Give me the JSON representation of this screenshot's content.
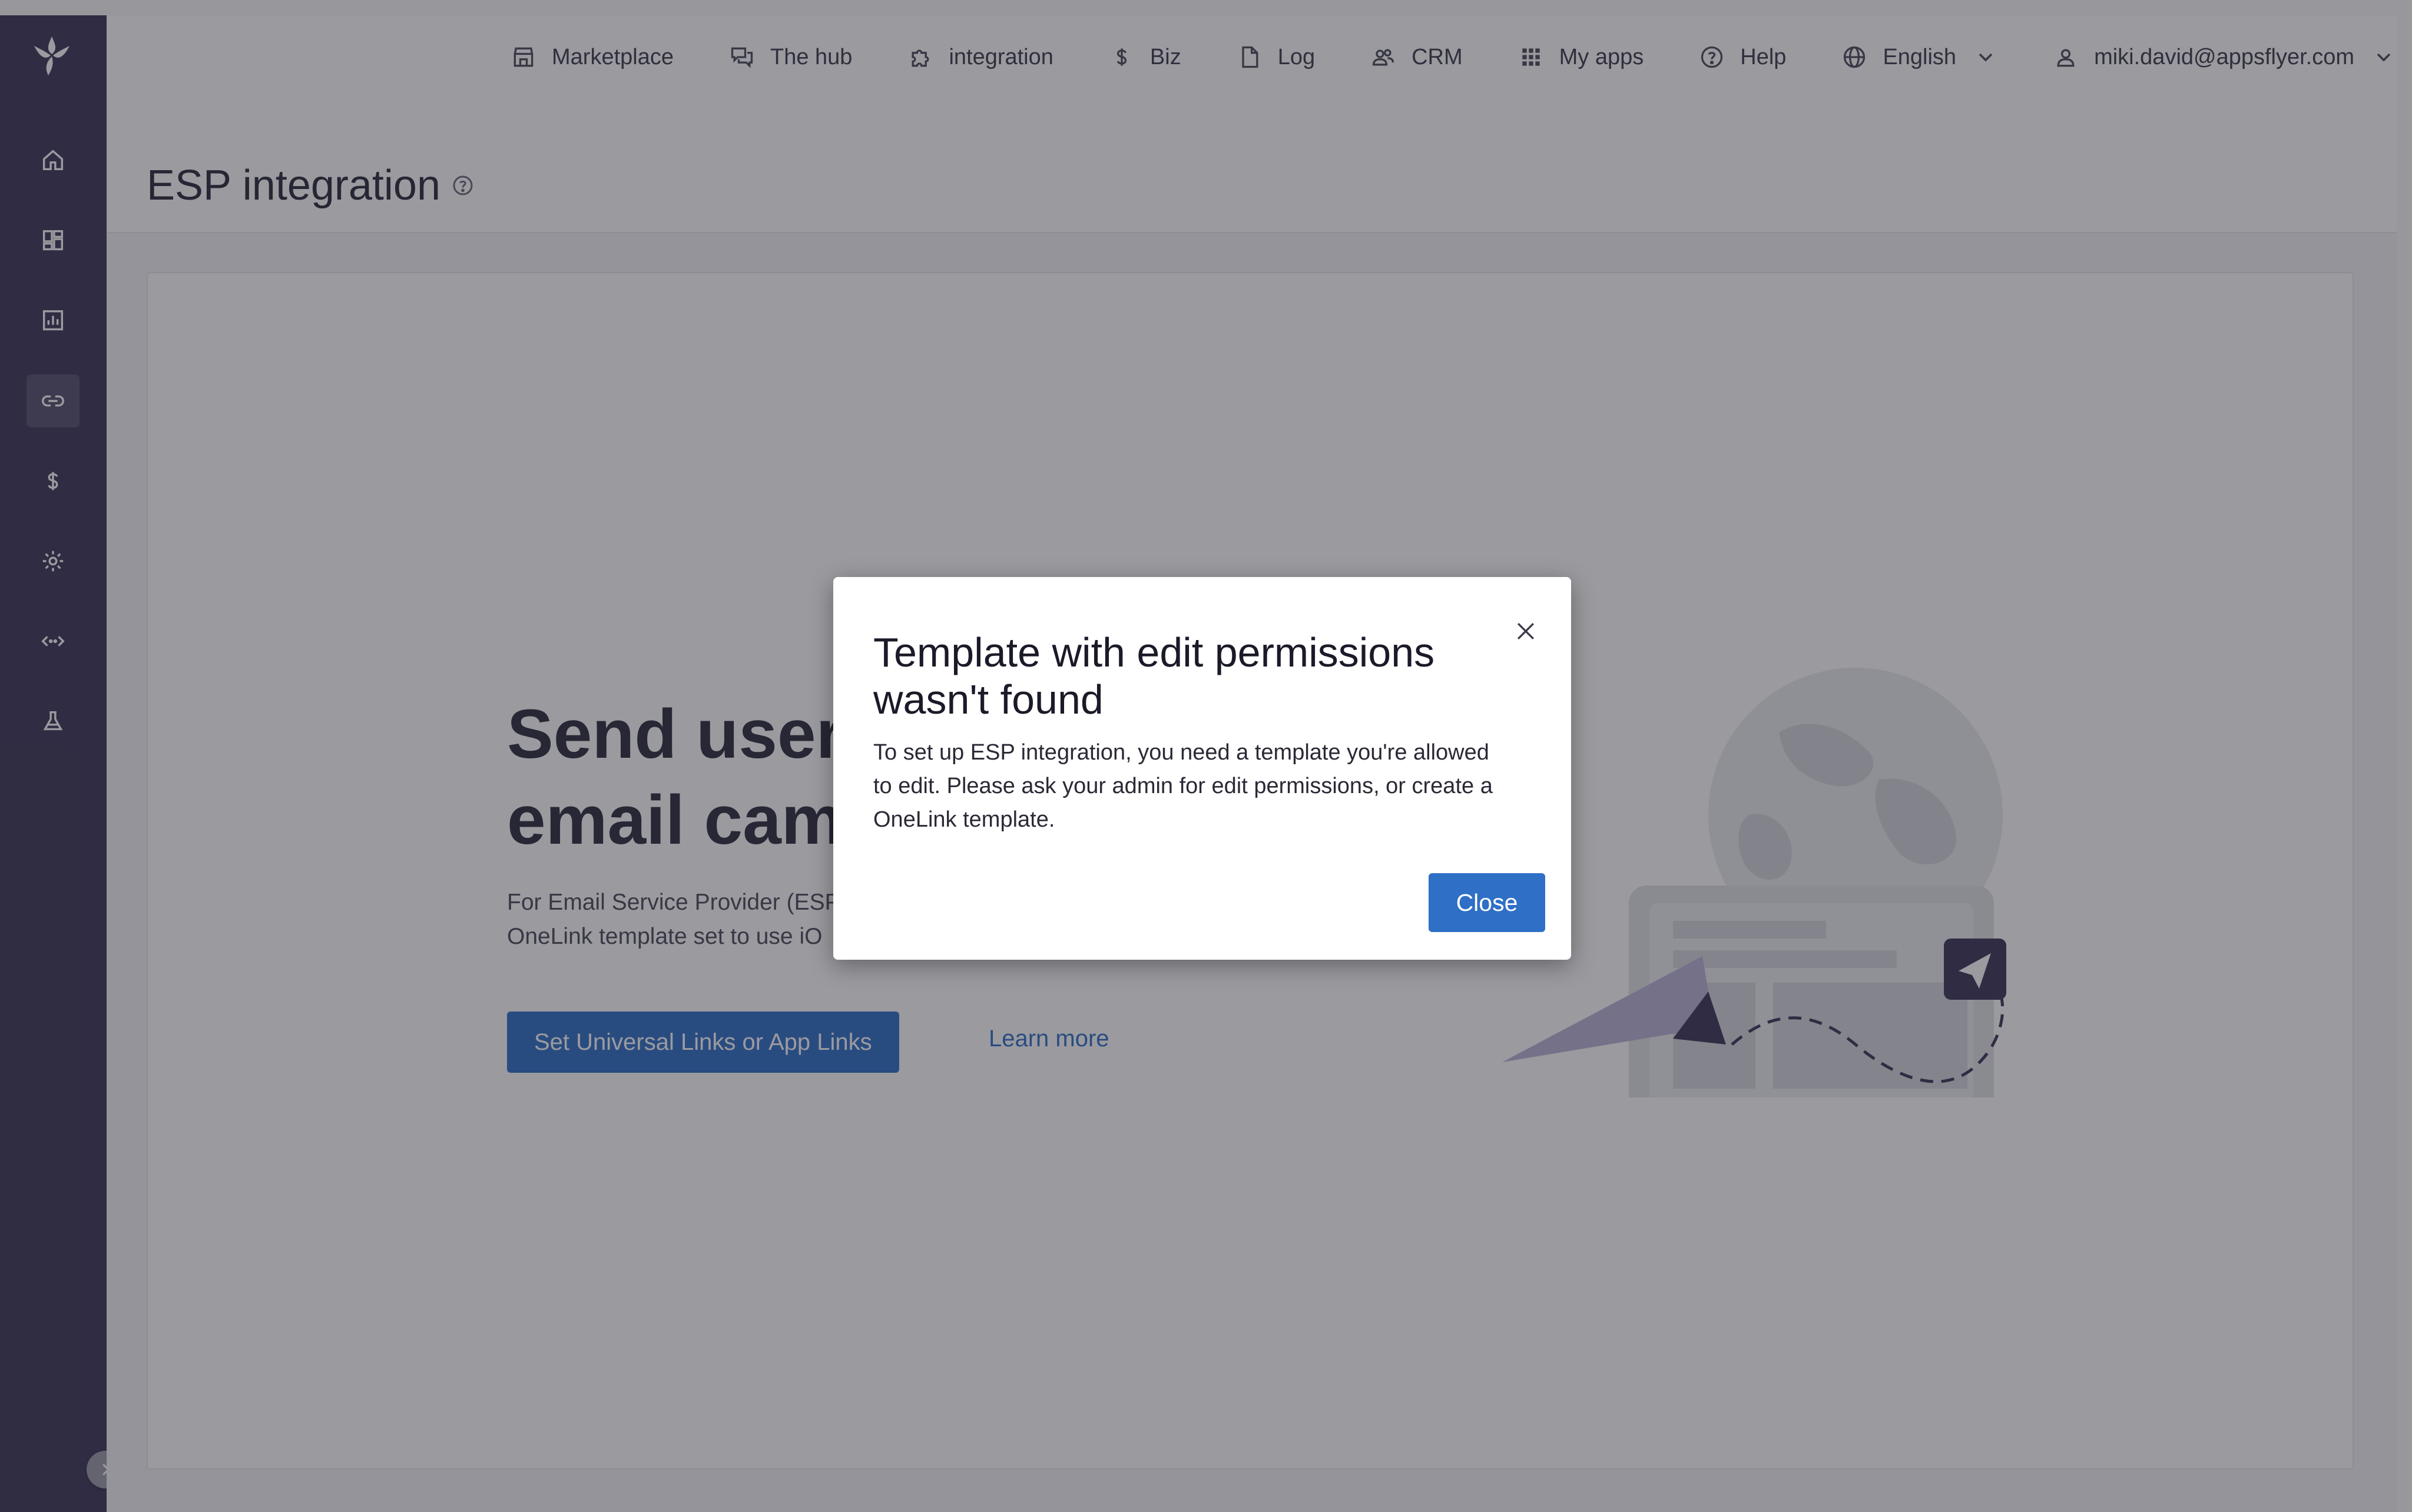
{
  "nav": {
    "items": [
      {
        "label": "Marketplace",
        "icon": "store-icon"
      },
      {
        "label": "The hub",
        "icon": "chat-icon"
      },
      {
        "label": "integration",
        "icon": "puzzle-icon"
      },
      {
        "label": "Biz",
        "icon": "dollar-icon"
      },
      {
        "label": "Log",
        "icon": "document-icon"
      },
      {
        "label": "CRM",
        "icon": "people-icon"
      },
      {
        "label": "My apps",
        "icon": "grid-icon"
      },
      {
        "label": "Help",
        "icon": "help-icon"
      }
    ],
    "language": "English",
    "user_email": "miki.david@appsflyer.com"
  },
  "sidebar": {
    "items": [
      {
        "icon": "home-icon"
      },
      {
        "icon": "dashboard-icon"
      },
      {
        "icon": "report-icon"
      },
      {
        "icon": "link-icon",
        "active": true
      },
      {
        "icon": "dollar-icon"
      },
      {
        "icon": "gear-icon"
      },
      {
        "icon": "code-icon"
      },
      {
        "icon": "flask-icon"
      }
    ]
  },
  "page": {
    "title": "ESP integration"
  },
  "hero": {
    "title_line1": "Send users",
    "title_line2": "email camp",
    "desc_line1": "For Email Service Provider (ESP",
    "desc_line2": "OneLink template set to use iO",
    "primary_button": "Set Universal Links or App Links",
    "learn_more": "Learn more"
  },
  "modal": {
    "title": "Template with edit permissions wasn't found",
    "body": "To set up ESP integration, you need a template you're allowed to edit.  Please ask your admin for edit permissions, or create a OneLink template.",
    "close_button": "Close"
  },
  "colors": {
    "sidebar_bg": "#3b3556",
    "accent_blue": "#2f6fc6",
    "illustration_purple": "#3b3556"
  }
}
